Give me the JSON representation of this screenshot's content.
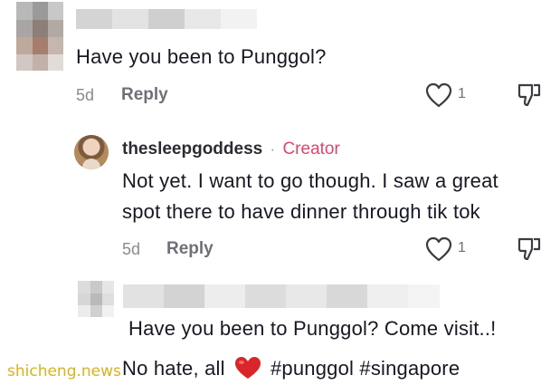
{
  "comments": [
    {
      "text": "Have you been to Punggol?",
      "time": "5d",
      "reply_label": "Reply",
      "like_count": "1"
    },
    {
      "username": "thesleepgoddess",
      "separator": "·",
      "badge": "Creator",
      "text_line1": "Not yet. I want to go though. I saw a great",
      "text_line2": "spot there to have dinner through tik tok",
      "time": "5d",
      "reply_label": "Reply",
      "like_count": "1"
    },
    {
      "text_line1": "Have you been to Punggol? Come visit..!",
      "text_line2_prefix": "No hate, all",
      "text_line2_suffix": "#punggol #singapore"
    }
  ],
  "watermark": "shicheng.news",
  "colors": {
    "creator_badge": "#e0456b",
    "heart_emoji": "#d9262a",
    "watermark": "#d9b21f"
  },
  "icons": [
    "heart-outline-icon",
    "dislike-icon",
    "red-heart-emoji"
  ]
}
